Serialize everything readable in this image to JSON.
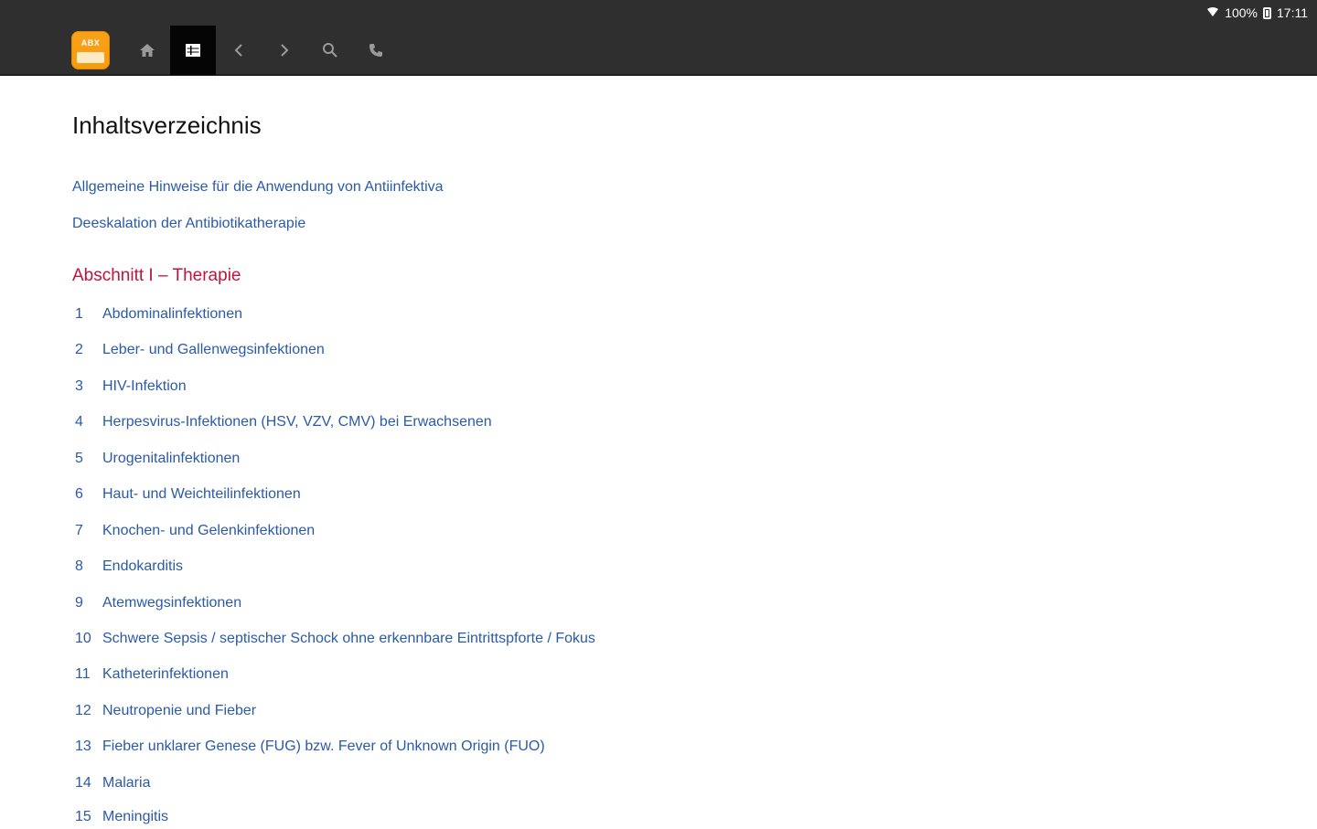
{
  "status_bar": {
    "battery_text": "100%",
    "time": "17:11",
    "icons": [
      "wifi-icon",
      "battery-icon"
    ]
  },
  "toolbar": {
    "app_logo_text": "ABX",
    "buttons": [
      "home-icon",
      "toc-icon",
      "back-icon",
      "forward-icon",
      "search-icon",
      "phone-icon"
    ],
    "active": "toc"
  },
  "page": {
    "title": "Inhaltsverzeichnis",
    "intro_links": [
      "Allgemeine Hinweise für die Anwendung von Antiinfektiva",
      "Deeskalation der Antibiotikatherapie"
    ],
    "section_title": "Abschnitt I – Therapie",
    "items": [
      {
        "num": "1",
        "label": "Abdominalinfektionen"
      },
      {
        "num": "2",
        "label": "Leber- und Gallenwegsinfektionen"
      },
      {
        "num": "3",
        "label": "HIV-Infektion"
      },
      {
        "num": "4",
        "label": "Herpesvirus-Infektionen (HSV, VZV, CMV) bei Erwachsenen"
      },
      {
        "num": "5",
        "label": "Urogenitalinfektionen"
      },
      {
        "num": "6",
        "label": "Haut- und Weichteilinfektionen"
      },
      {
        "num": "7",
        "label": "Knochen- und Gelenkinfektionen"
      },
      {
        "num": "8",
        "label": "Endokarditis"
      },
      {
        "num": "9",
        "label": "Atemwegsinfektionen"
      },
      {
        "num": "10",
        "label": "Schwere Sepsis / septischer Schock ohne erkennbare Eintrittspforte / Fokus"
      },
      {
        "num": "11",
        "label": "Katheterinfektionen"
      },
      {
        "num": "12",
        "label": "Neutropenie und Fieber"
      },
      {
        "num": "13",
        "label": "Fieber unklarer Genese (FUG) bzw. Fever of Unknown Origin (FUO)"
      },
      {
        "num": "14",
        "label": "Malaria"
      },
      {
        "num": "15",
        "label": "Meningitis"
      }
    ]
  },
  "colors": {
    "topbar": "#2f2f2f",
    "link": "#2a5aa8",
    "section": "#c0143c",
    "logo": "#f59c0e"
  }
}
